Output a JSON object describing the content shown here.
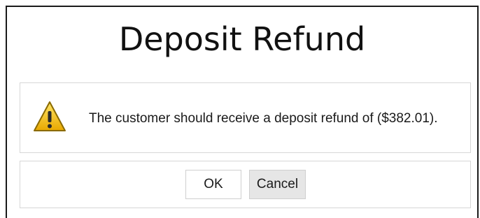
{
  "dialog": {
    "title": "Deposit Refund",
    "message": "The customer should receive a deposit refund of ($382.01).",
    "icon": "warning-icon",
    "buttons": {
      "ok_label": "OK",
      "cancel_label": "Cancel"
    }
  },
  "colors": {
    "warning_yellow": "#f2c400",
    "warning_outline": "#8a6a00",
    "cancel_button_bg": "#e6e6e6"
  }
}
